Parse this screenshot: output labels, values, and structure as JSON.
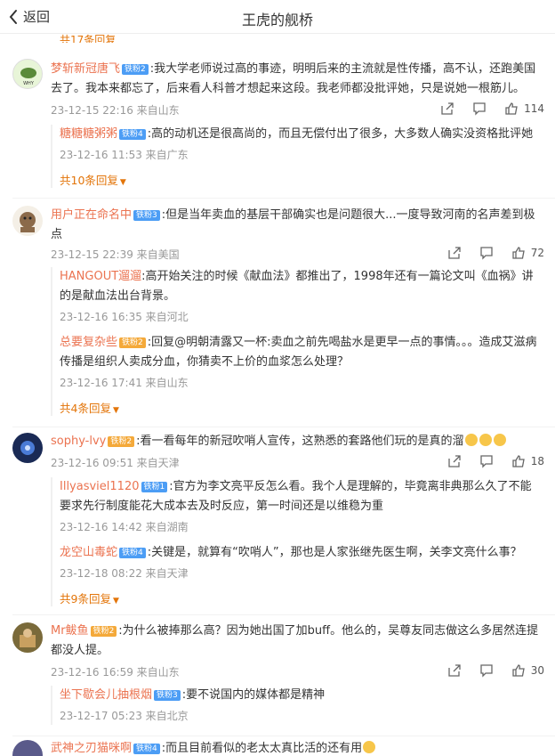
{
  "header": {
    "back_label": "返回",
    "title": "王虎的舰桥"
  },
  "top_more": "共17条回复",
  "comments": [
    {
      "username": "梦斩新冠唐飞",
      "badge": "铁粉2",
      "text": ":我大学老师说过高的事迹，明明后来的主流就是性传播，高不认，还跑美国去了。我本来都忘了，后来看人科普才想起来这段。我老师都没批评她，只是说她一根筋儿。",
      "meta": "23-12-15 22:16 来自山东",
      "likes": "114",
      "replies": [
        {
          "username": "糖糖糖粥粥",
          "badge": "铁粉4",
          "text": ":高的动机还是很高尚的，而且无偿付出了很多，大多数人确实没资格批评她",
          "meta": "23-12-16 11:53 来自广东"
        }
      ],
      "more": "共10条回复"
    },
    {
      "username": "用户正在命名中",
      "badge": "铁粉3",
      "text": ":但是当年卖血的基层干部确实也是问题很大...一度导致河南的名声差到极点",
      "meta": "23-12-15 22:39 来自美国",
      "likes": "72",
      "replies": [
        {
          "username": "HANGOUT遛遛",
          "badge": "",
          "text": ":高开始关注的时候《献血法》都推出了，1998年还有一篇论文叫《血祸》讲的是献血法出台背景。",
          "meta": "23-12-16 16:35 来自河北"
        },
        {
          "username": "总要复杂些",
          "badge": "铁粉2",
          "text": ":回复@明朝清露又一杯:卖血之前先喝盐水是更早一点的事情。。。造成艾滋病传播是组织人卖成分血，你猜卖不上价的血浆怎么处理？",
          "meta": "23-12-16 17:41 来自山东"
        }
      ],
      "more": "共4条回复"
    },
    {
      "username": "sophy-lvy",
      "badge": "铁粉2",
      "text": ":看一看每年的新冠吹哨人宣传，这熟悉的套路他们玩的是真的溜",
      "meta": "23-12-16 09:51 来自天津",
      "likes": "18",
      "replies": [
        {
          "username": "Illyasviel1120",
          "badge": "铁粉1",
          "text": ":官方为李文亮平反怎么看。我个人是理解的，毕竟离非典那么久了不能要求先行制度能花大成本去及时反应，第一时间还是以维稳为重",
          "meta": "23-12-16 14:42 来自湖南"
        },
        {
          "username": "龙空山毒蛇",
          "badge": "铁粉4",
          "text": ":关键是，就算有“吹哨人”，那也是人家张继先医生啊，关李文亮什么事？",
          "meta": "23-12-18 08:22 来自天津"
        }
      ],
      "more": "共9条回复"
    },
    {
      "username": "Mr鲅鱼",
      "badge": "铁粉2",
      "text": ":为什么被捧那么高？因为她出国了加buff。他么的，吴尊友同志做这么多居然连提都没人提。",
      "meta": "23-12-16 16:59 来自山东",
      "likes": "30",
      "replies": [
        {
          "username": "坐下歇会儿抽根烟",
          "badge": "铁粉3",
          "text": ":要不说国内的媒体都是精神",
          "meta": "23-12-17 05:23 来自北京"
        }
      ],
      "more": ""
    },
    {
      "username": "武神之刃猫咪啊",
      "badge": "铁粉4",
      "text": ":而且目前看似的老太太真比活的还有用",
      "meta": "",
      "likes": "",
      "replies": [],
      "more": ""
    }
  ]
}
